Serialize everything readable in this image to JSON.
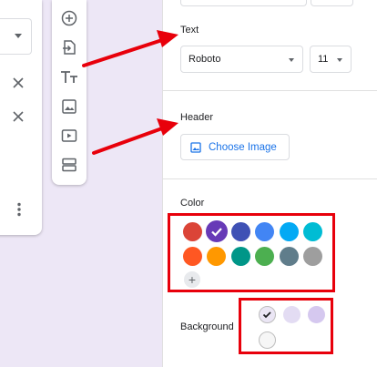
{
  "text_section": {
    "label": "Text",
    "font_select": {
      "value": "Roboto"
    },
    "size_select": {
      "value": "11"
    }
  },
  "header_section": {
    "label": "Header",
    "choose_image_label": "Choose Image"
  },
  "color_section": {
    "label": "Color",
    "swatches": [
      {
        "color": "#db4437"
      },
      {
        "color": "#673ab7",
        "selected": true
      },
      {
        "color": "#3f51b5"
      },
      {
        "color": "#4285f4"
      },
      {
        "color": "#03a9f4"
      },
      {
        "color": "#00bcd4"
      },
      {
        "color": "#ff5722"
      },
      {
        "color": "#ff9800"
      },
      {
        "color": "#009688"
      },
      {
        "color": "#4caf50"
      },
      {
        "color": "#607d8b"
      },
      {
        "color": "#9e9e9e"
      }
    ],
    "add_icon": "plus-icon"
  },
  "background_section": {
    "label": "Background",
    "swatches": [
      {
        "color": "#ebe6f5",
        "selected": true
      },
      {
        "color": "#e3dcf3"
      },
      {
        "color": "#d5c8ef"
      },
      {
        "color": "#f6f6f6"
      }
    ]
  },
  "annotation_color": "#e8000b",
  "toolbar_icons": [
    "add-question-icon",
    "import-questions-icon",
    "add-title-icon",
    "add-image-icon",
    "add-video-icon",
    "add-section-icon"
  ],
  "left_card_icons": [
    "close-icon",
    "close-icon",
    "more-vert-icon"
  ]
}
